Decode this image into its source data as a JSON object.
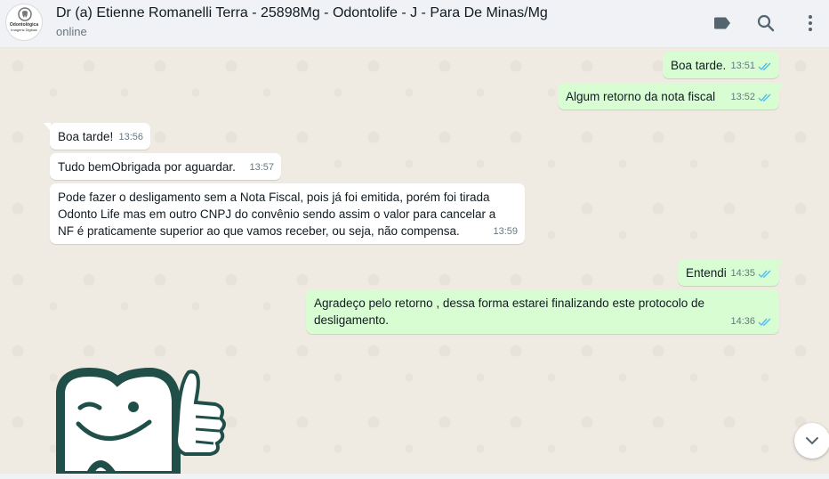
{
  "header": {
    "contact_name": "Dr (a) Etienne Romanelli Terra - 25898Mg - Odontolife - J - Para De Minas/Mg",
    "status": "online",
    "avatar_text_1": "Odontológica",
    "avatar_text_2": "Imagens Digitais",
    "icons": [
      "label-icon",
      "search-icon",
      "menu-icon"
    ]
  },
  "messages": [
    {
      "direction": "out",
      "text": "Boa tarde.",
      "time": "13:51",
      "read": true
    },
    {
      "direction": "out",
      "text": "Algum retorno  da nota fiscal",
      "time": "13:52",
      "read": true
    },
    {
      "direction": "in",
      "text": "Boa tarde!",
      "time": "13:56"
    },
    {
      "direction": "in",
      "text": "Tudo bemObrigada por aguardar.",
      "time": "13:57"
    },
    {
      "direction": "in",
      "text": "Pode fazer o desligamento sem a Nota Fiscal, pois já foi emitida, porém foi tirada Odonto Life mas em outro CNPJ do convênio sendo assim o valor para cancelar a NF é praticamente superior ao que vamos receber, ou seja, não compensa.",
      "time": "13:59"
    },
    {
      "direction": "out",
      "text": "Entendi",
      "time": "14:35",
      "read": true
    },
    {
      "direction": "out",
      "text": "Agradeço pelo retorno , dessa forma estarei finalizando este protocolo de desligamento.",
      "time": "14:36",
      "read": true
    }
  ],
  "colors": {
    "outgoing_bubble": "#d9fdd3",
    "incoming_bubble": "#ffffff",
    "read_ticks": "#53bdeb",
    "header_bg": "#f0f2f5",
    "chat_bg": "#efeae2",
    "sticker_tooth": "#1f4f48"
  }
}
